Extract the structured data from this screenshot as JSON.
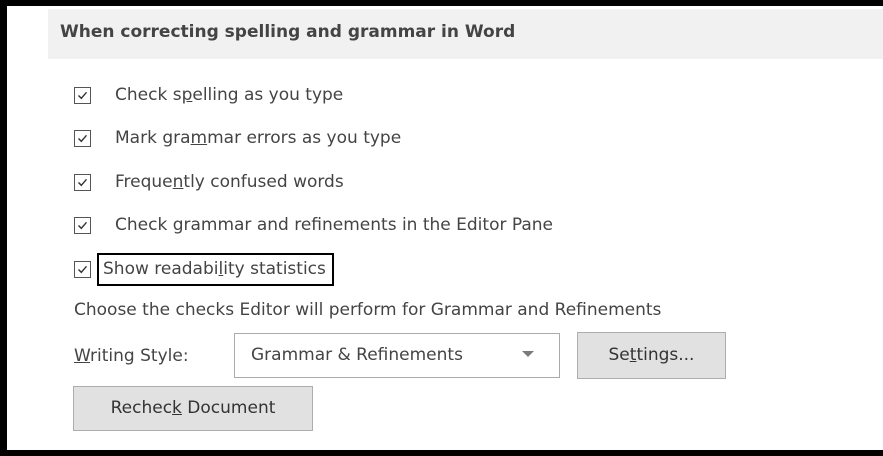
{
  "section": {
    "title": "When correcting spelling and grammar in Word"
  },
  "options": [
    {
      "before": "Check s",
      "key": "p",
      "after": "elling as you type",
      "checked": true
    },
    {
      "before": "Mark gra",
      "key": "m",
      "after": "mar errors as you type",
      "checked": true
    },
    {
      "before": "Freque",
      "key": "n",
      "after": "tly confused words",
      "checked": true
    },
    {
      "before": "Check grammar and refinements in the Editor Pane",
      "key": "",
      "after": "",
      "checked": true
    },
    {
      "before": "Show readabi",
      "key": "l",
      "after": "ity statistics",
      "checked": true
    }
  ],
  "caption": "Choose the checks Editor will perform for Grammar and Refinements",
  "writing_style": {
    "label_key": "W",
    "label_rest": "riting Style:",
    "selected": "Grammar & Refinements"
  },
  "settings_button": {
    "before": "Se",
    "key": "t",
    "after": "tings..."
  },
  "recheck_button": {
    "before": "Rechec",
    "key": "k",
    "after": " Document"
  },
  "colors": {
    "header_bg": "#f1f1f1",
    "text": "#444444",
    "button_bg": "#e1e1e1",
    "focus_border": "#000000"
  }
}
